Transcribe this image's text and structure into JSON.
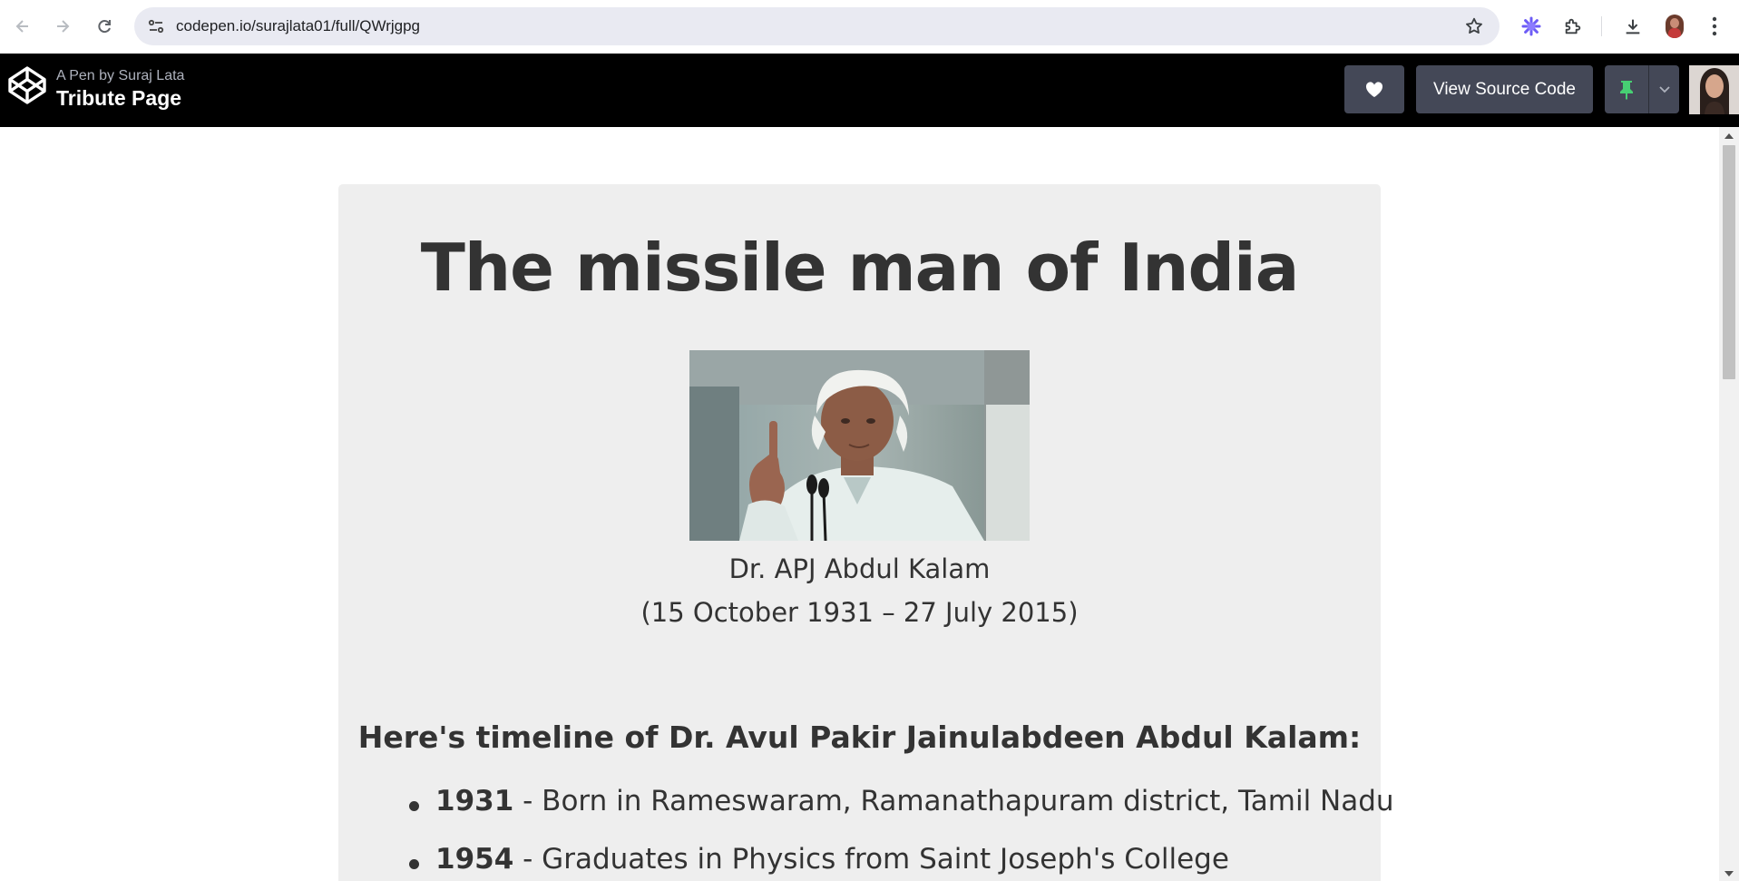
{
  "browser": {
    "url": "codepen.io/surajlata01/full/QWrjgpg",
    "icons": [
      "back-arrow",
      "forward-arrow",
      "reload",
      "site-info",
      "bookmark-star",
      "extension-colorful",
      "extensions-puzzle",
      "download",
      "profile",
      "more-vert"
    ]
  },
  "codepen_header": {
    "byline": "A Pen by Suraj Lata",
    "title": "Tribute Page",
    "view_source_label": "View Source Code",
    "icons": [
      "codepen-logo",
      "heart-icon",
      "pin-icon",
      "chevron-down-icon"
    ],
    "colors": {
      "background": "#000000",
      "button": "#444857",
      "pin": "#47cf73"
    }
  },
  "tribute": {
    "heading": "The missile man of India",
    "image_alt": "Dr. APJ Abdul Kalam",
    "caption_name": "Dr. APJ Abdul Kalam",
    "caption_dates": "(15 October 1931 – 27 July 2015)",
    "timeline_heading": "Here's timeline of Dr. Avul Pakir Jainulabdeen Abdul Kalam:",
    "timeline": [
      {
        "year": "1931",
        "text": " - Born in Rameswaram, Ramanathapuram district, Tamil Nadu"
      },
      {
        "year": "1954",
        "text": " - Graduates in Physics from Saint Joseph's College"
      }
    ],
    "colors": {
      "card": "#eeeeee",
      "text": "#333333"
    }
  }
}
